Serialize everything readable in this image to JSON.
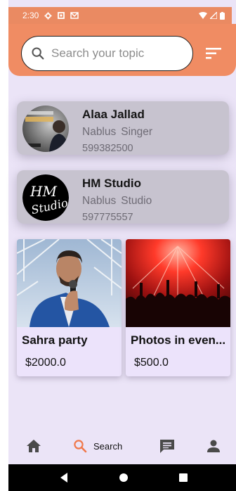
{
  "status_bar": {
    "time": "2:30"
  },
  "search": {
    "placeholder": "Search your topic"
  },
  "people": [
    {
      "name": "Alaa Jallad",
      "city": "Nablus",
      "role": "Singer",
      "phone": "599382500"
    },
    {
      "name": "HM Studio",
      "city": "Nablus",
      "role": "Studio",
      "phone": "597775557"
    }
  ],
  "services": [
    {
      "title": "Sahra party",
      "price": "$2000.0"
    },
    {
      "title": "Photos in even...",
      "price": "$500.0"
    }
  ],
  "bottom_nav": {
    "items": [
      {
        "icon": "home-icon"
      },
      {
        "icon": "search-icon",
        "label": "Search",
        "active": true
      },
      {
        "icon": "chat-icon"
      },
      {
        "icon": "profile-icon"
      }
    ]
  },
  "colors": {
    "accent": "#f08c63",
    "background": "#ebe4f7",
    "active_icon": "#f0784a"
  }
}
